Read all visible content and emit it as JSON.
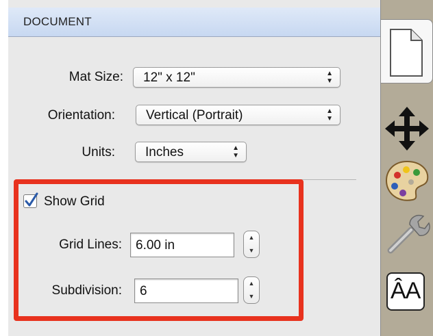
{
  "panel": {
    "title": "DOCUMENT"
  },
  "document": {
    "mat_size": {
      "label": "Mat Size:",
      "value": "12\" x 12\""
    },
    "orientation": {
      "label": "Orientation:",
      "value": "Vertical (Portrait)"
    },
    "units": {
      "label": "Units:",
      "value": "Inches"
    }
  },
  "grid": {
    "show_grid": {
      "label": "Show Grid",
      "checked": true
    },
    "grid_lines": {
      "label": "Grid Lines:",
      "value": "6.00 in"
    },
    "subdivision": {
      "label": "Subdivision:",
      "value": "6"
    }
  },
  "sidebar": {
    "tabs": [
      "document-icon",
      "move-icon",
      "palette-icon",
      "wrench-icon",
      "text-size-icon"
    ],
    "text_icon_label": "ÂA"
  },
  "colors": {
    "highlight": "#e8321e",
    "header": "#c7d8f1",
    "sidebar": "#b3ab98"
  }
}
